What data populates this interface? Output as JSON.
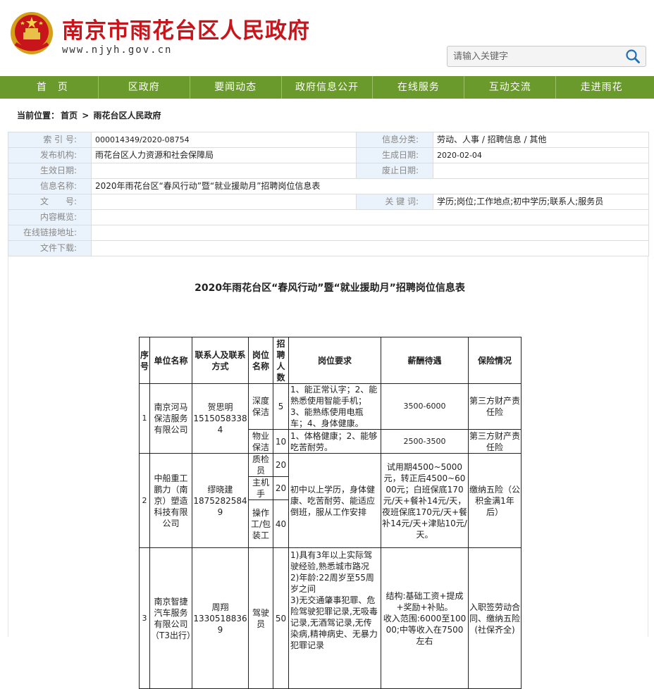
{
  "header": {
    "title": "南京市雨花台区人民政府",
    "url": "www.njyh.gov.cn",
    "search_placeholder": "请输入关键字"
  },
  "nav": [
    "首　页",
    "区政府",
    "要闻动态",
    "政府信息公开",
    "在线服务",
    "互动交流",
    "走进雨花"
  ],
  "breadcrumb": {
    "prefix": "当前位置：",
    "home": "首页",
    "sep": " > ",
    "current": "雨花台区人民政府"
  },
  "meta": {
    "index_label": "索 引 号:",
    "index_value": "000014349/2020-08754",
    "category_label": "信息分类:",
    "category_value": "劳动、人事 / 招聘信息 / 其他",
    "publisher_label": "发布机构:",
    "publisher_value": "雨花台区人力资源和社会保障局",
    "date_label": "生成日期:",
    "date_value": "2020-02-04",
    "effective_label": "生效日期:",
    "effective_value": "",
    "expire_label": "废止日期:",
    "expire_value": "",
    "name_label": "信息名称:",
    "name_value": "2020年雨花台区“春风行动”暨“就业援助月”招聘岗位信息表",
    "docno_label": "文　　号:",
    "docno_value": "",
    "keywords_label": "关 键 词:",
    "keywords_value": "学历;岗位;工作地点;初中学历;联系人;服务员",
    "summary_label": "内容概览:",
    "summary_value": "",
    "link_label": "在线链接地址:",
    "link_value": "",
    "download_label": "文件下载:",
    "download_value": ""
  },
  "doc_title": "2020年雨花台区“春风行动”暨“就业援助月”招聘岗位信息表",
  "jobs": {
    "headers": [
      "序号",
      "单位名称",
      "联系人及联系方式",
      "岗位名称",
      "招聘人数",
      "岗位要求",
      "薪酬待遇",
      "保险情况"
    ],
    "r1": {
      "no": "1",
      "company": "南京河马保洁服务有限公司",
      "contact": "贺思明\n15150583384",
      "pos1": "深度保洁",
      "num1": "5",
      "req1": "1、能正常认字；2、能熟悉使用智能手机；3、能熟练使用电瓶车；4、身体健康。",
      "pay1": "3500-6000",
      "ins1": "第三方财产责任险",
      "pos2": "物业保洁",
      "num2": "10",
      "req2": "1、体格健康；2、能够吃苦耐劳。",
      "pay2": "2500-3500",
      "ins2": "第三方财产责任险"
    },
    "r2": {
      "no": "2",
      "company": "中船重工鹏力（南京）塑造科技有限公司",
      "contact": "缪晓建\n18752825849",
      "pos1": "质检员",
      "num1": "20",
      "pos2": "主机手",
      "num2": "20",
      "pos3": "操作工/包装工",
      "num3": "40",
      "req": "初中以上学历，身体健康、吃苦耐劳、能适应倒班，服从工作安排",
      "pay": "试用期4500~5000元，转正后4500~6000元；白班保底170元/天+餐补14元/天，夜班保底170元/天+餐补14元/天+津贴10元/天。",
      "ins": "缴纳五险（公积金满1年后）"
    },
    "r3": {
      "no": "3",
      "company": "南京智捷汽车服务有限公司（T3出行）",
      "contact": "周翔\n13305188369",
      "pos": "驾驶员",
      "num": "50",
      "req": "1)具有3年以上实际驾驶经验,熟悉城市路况\n2)年龄:22周岁至55周岁之间\n3)无交通肇事犯罪、危险驾驶犯罪记录,无吸毒记录,无酒驾记录,无传染病,精神病史、无暴力犯罪记录",
      "pay": "结构:基础工资+提成+奖励+补贴。\n收入范围:6000至10000;中等收入在7500左右",
      "ins": "入职签劳动合同、缴纳五险(社保齐全)"
    }
  },
  "colors": {
    "nav": "#6a9a2b",
    "title_red": "#c8151b",
    "meta_label_bg": "#eaf2fb"
  },
  "icons": {
    "emblem": "national-emblem-icon",
    "search": "search-icon"
  }
}
